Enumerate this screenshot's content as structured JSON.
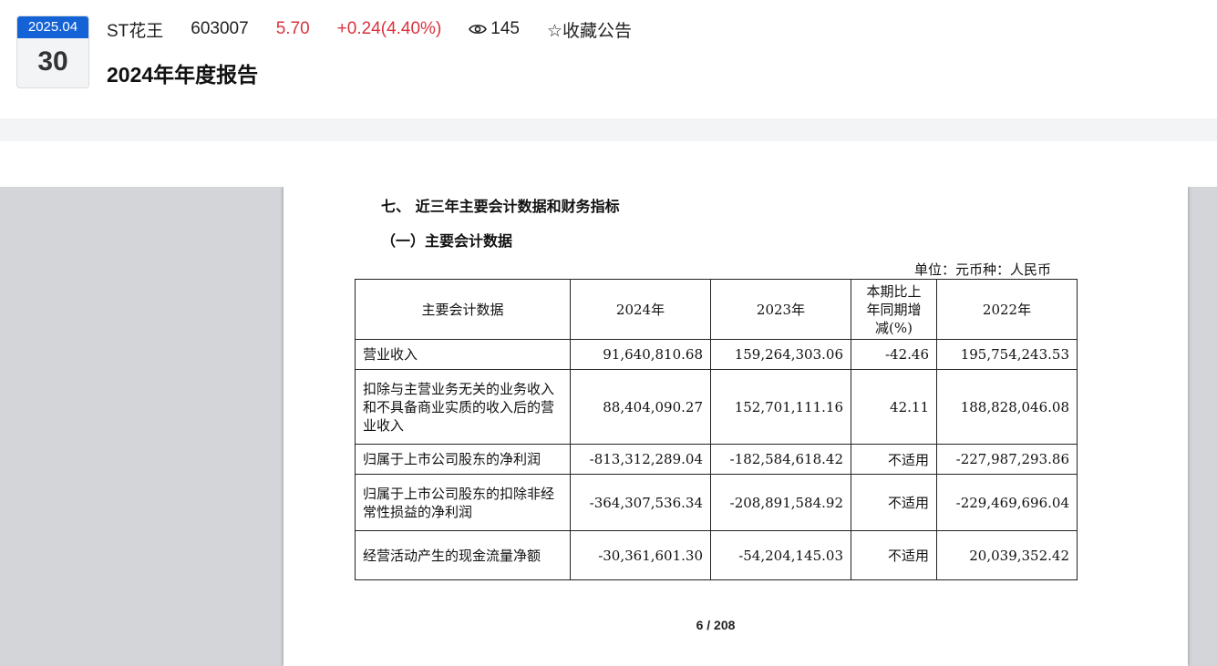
{
  "header": {
    "date": {
      "year_month": "2025.04",
      "day": "30"
    },
    "stock_name": "ST花王",
    "stock_code": "603007",
    "price": "5.70",
    "change": "+0.24(4.40%)",
    "views": "145",
    "favorite_label": "☆收藏公告",
    "doc_title": "2024年年度报告",
    "colors": {
      "badge_blue": "#1463d6",
      "up_red": "#d9333f"
    }
  },
  "document": {
    "section_title": "七、 近三年主要会计数据和财务指标",
    "subsection_title": "（一）主要会计数据",
    "unit_note": "单位：元币种：人民币",
    "table": {
      "headers": [
        "主要会计数据",
        "2024年",
        "2023年",
        "本期比上年同期增减(%)",
        "2022年"
      ],
      "rows": [
        [
          "营业收入",
          "91,640,810.68",
          "159,264,303.06",
          "-42.46",
          "195,754,243.53"
        ],
        [
          "扣除与主营业务无关的业务收入和不具备商业实质的收入后的营业收入",
          "88,404,090.27",
          "152,701,111.16",
          "42.11",
          "188,828,046.08"
        ],
        [
          "归属于上市公司股东的净利润",
          "-813,312,289.04",
          "-182,584,618.42",
          "不适用",
          "-227,987,293.86"
        ],
        [
          "归属于上市公司股东的扣除非经常性损益的净利润",
          "-364,307,536.34",
          "-208,891,584.92",
          "不适用",
          "-229,469,696.04"
        ],
        [
          "经营活动产生的现金流量净额",
          "-30,361,601.30",
          "-54,204,145.03",
          "不适用",
          "20,039,352.42"
        ]
      ]
    },
    "page_indicator": "6 / 208"
  }
}
